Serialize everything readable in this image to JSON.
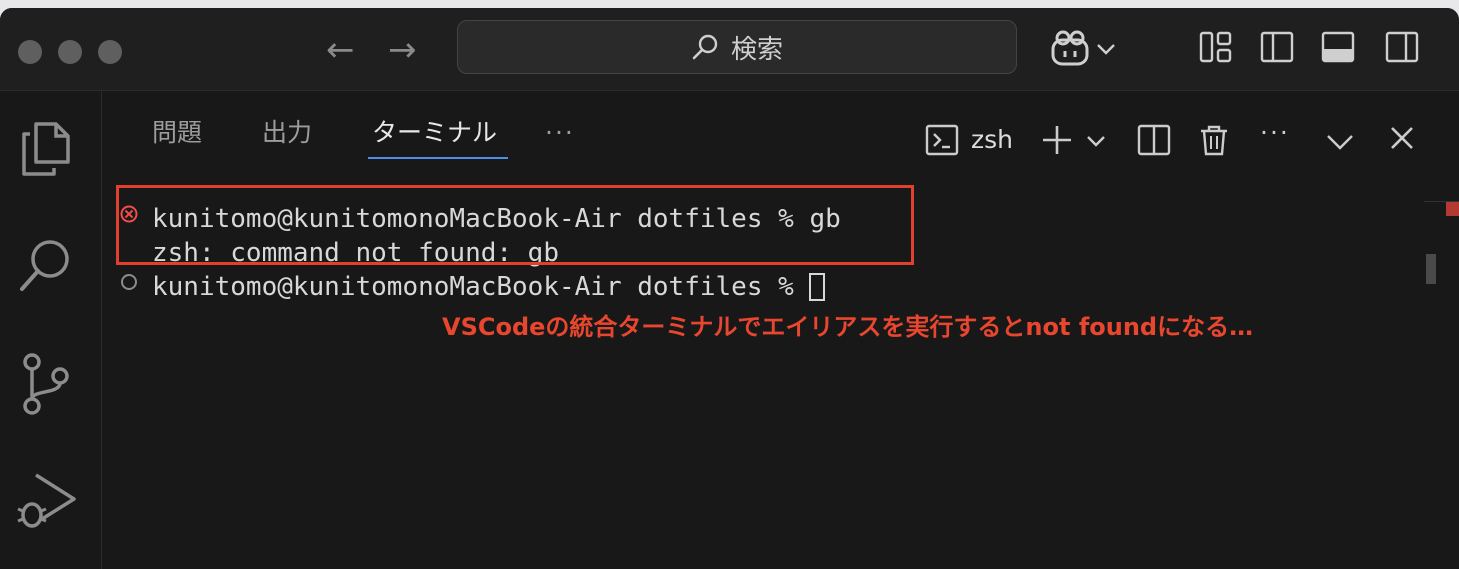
{
  "titlebar": {
    "search_placeholder": "検索"
  },
  "panel": {
    "tabs": [
      {
        "label": "問題"
      },
      {
        "label": "出力"
      },
      {
        "label": "ターミナル"
      }
    ],
    "more_label": "···",
    "shell_name": "zsh"
  },
  "terminal": {
    "lines": [
      "kunitomo@kunitomonoMacBook-Air dotfiles % gb",
      "zsh: command not found: gb",
      "kunitomo@kunitomonoMacBook-Air dotfiles % "
    ]
  },
  "annotation": {
    "text": "VSCodeの統合ターミナルでエイリアスを実行するとnot foundになる…",
    "color": "#e8462e"
  },
  "colors": {
    "accent": "#4d8fe6",
    "error": "#e0402c"
  }
}
